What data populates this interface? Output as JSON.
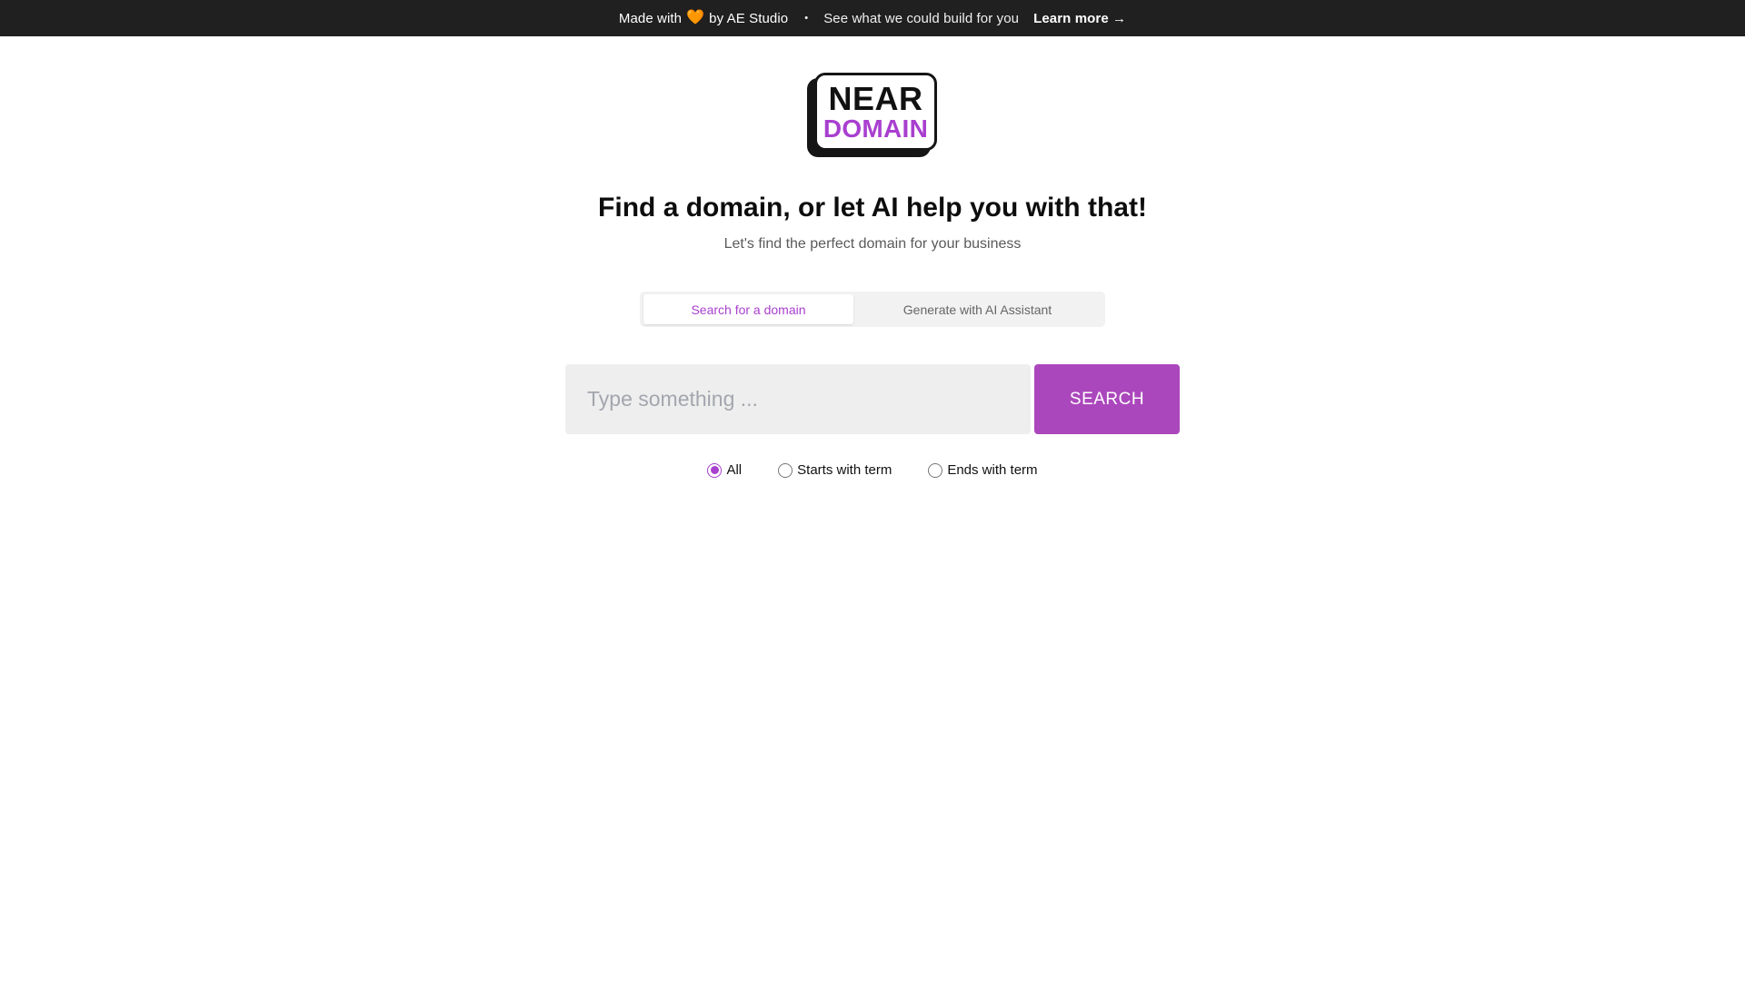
{
  "banner": {
    "made_with": "Made with",
    "heart": "🧡",
    "by": "by AE Studio",
    "separator": "•",
    "pitch": "See what we could build for you",
    "learn_more": "Learn more →"
  },
  "logo": {
    "line1": "NEAR",
    "line2": "DOMAIN"
  },
  "hero": {
    "title": "Find a domain, or let AI help you with that!",
    "subtitle": "Let's find the perfect domain for your business"
  },
  "tabs": [
    {
      "label": "Search for a domain",
      "active": true
    },
    {
      "label": "Generate with AI Assistant",
      "active": false
    }
  ],
  "search": {
    "value": "",
    "placeholder": "Type something ...",
    "button_label": "SEARCH"
  },
  "match_options": {
    "selected": "All",
    "options": [
      "All",
      "Starts with term",
      "Ends with term"
    ]
  },
  "colors": {
    "accent": "#ab47bc",
    "banner_bg": "#202020",
    "heart": "#f5841f"
  }
}
